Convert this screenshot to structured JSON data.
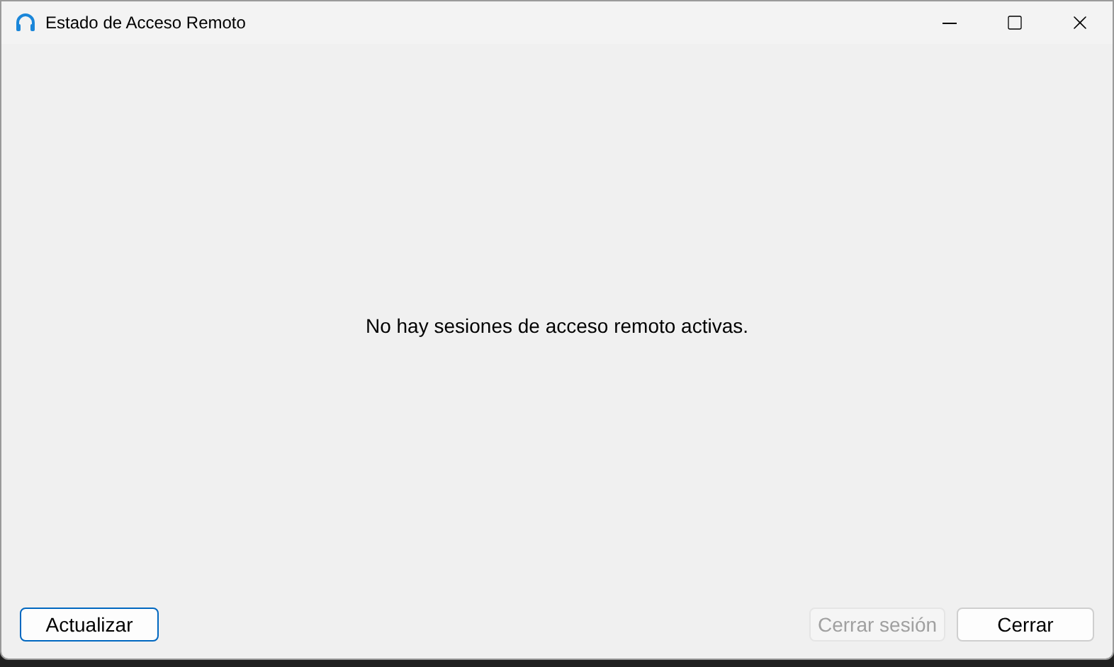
{
  "window": {
    "title": "Estado de Acceso Remoto"
  },
  "message": "No hay sesiones de acceso remoto activas.",
  "buttons": [
    {
      "label": "Actualizar",
      "disabled": false,
      "focused": true
    },
    {
      "label": "Cerrar sesión",
      "disabled": true,
      "focused": false
    },
    {
      "label": "Cerrar",
      "disabled": false,
      "focused": false
    }
  ]
}
